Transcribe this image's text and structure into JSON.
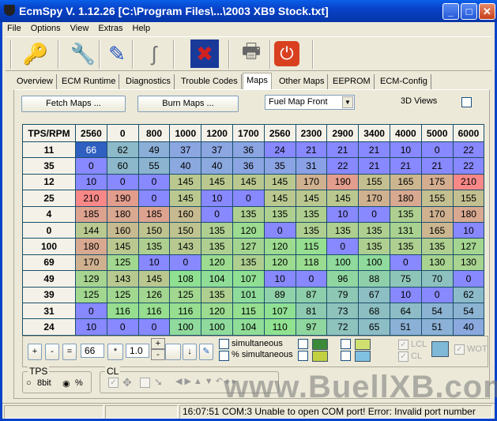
{
  "window": {
    "title": "EcmSpy V. 1.12.26  [C:\\Program Files\\...\\2003 XB9 Stock.txt]"
  },
  "menu": [
    "File",
    "Options",
    "View",
    "Extras",
    "Help"
  ],
  "toolbar": [
    {
      "icon": "keys-icon",
      "glyph": "🔑"
    },
    {
      "icon": "tools-gear-icon",
      "glyph": "🔧"
    },
    {
      "icon": "chip-edit-icon",
      "glyph": "✎"
    },
    {
      "icon": "serial-cable-icon",
      "glyph": "ʃ"
    },
    {
      "icon": "disk-crossed-icon",
      "glyph": "✖"
    },
    {
      "icon": "printer-icon",
      "glyph": "🖶"
    },
    {
      "icon": "power-icon",
      "glyph": "⏻"
    }
  ],
  "tabs": [
    "Overview",
    "ECM Runtime",
    "Diagnostics",
    "Trouble Codes",
    "Maps",
    "Other Maps",
    "EEPROM",
    "ECM-Config"
  ],
  "active_tab": "Maps",
  "maps": {
    "fetch_label": "Fetch Maps ...",
    "burn_label": "Burn Maps ...",
    "map_select": "Fuel Map Front",
    "views_3d_label": "3D Views",
    "corner": "TPS/RPM",
    "rpm": [
      "2560",
      "0",
      "800",
      "1000",
      "1200",
      "1700",
      "2560",
      "2300",
      "2900",
      "3400",
      "4000",
      "5000",
      "6000"
    ],
    "rows": [
      {
        "tps": "11",
        "v": [
          66,
          62,
          49,
          37,
          37,
          36,
          24,
          21,
          21,
          21,
          10,
          0,
          22
        ]
      },
      {
        "tps": "35",
        "v": [
          0,
          60,
          55,
          40,
          40,
          36,
          35,
          31,
          22,
          21,
          21,
          21,
          22
        ]
      },
      {
        "tps": "12",
        "v": [
          10,
          0,
          0,
          145,
          145,
          145,
          145,
          170,
          190,
          155,
          165,
          175,
          210
        ]
      },
      {
        "tps": "25",
        "v": [
          210,
          190,
          0,
          145,
          10,
          0,
          145,
          145,
          145,
          170,
          180,
          155,
          155
        ]
      },
      {
        "tps": "4",
        "v": [
          185,
          180,
          185,
          160,
          0,
          135,
          135,
          135,
          10,
          0,
          135,
          170,
          180
        ]
      },
      {
        "tps": "0",
        "v": [
          144,
          160,
          150,
          150,
          135,
          120,
          0,
          135,
          135,
          135,
          131,
          165,
          10
        ]
      },
      {
        "tps": "100",
        "v": [
          180,
          145,
          135,
          143,
          135,
          127,
          120,
          115,
          0,
          135,
          135,
          135,
          127
        ]
      },
      {
        "tps": "69",
        "v": [
          170,
          125,
          10,
          0,
          120,
          135,
          120,
          118,
          100,
          100,
          0,
          130,
          130
        ]
      },
      {
        "tps": "49",
        "v": [
          129,
          143,
          145,
          108,
          104,
          107,
          10,
          0,
          96,
          88,
          75,
          70,
          0
        ]
      },
      {
        "tps": "39",
        "v": [
          125,
          125,
          126,
          125,
          135,
          101,
          89,
          87,
          79,
          67,
          10,
          0,
          62
        ]
      },
      {
        "tps": "31",
        "v": [
          0,
          116,
          116,
          116,
          120,
          115,
          107,
          81,
          73,
          68,
          64,
          54,
          54
        ]
      },
      {
        "tps": "24",
        "v": [
          10,
          0,
          0,
          100,
          100,
          104,
          110,
          97,
          72,
          65,
          51,
          51,
          40
        ]
      }
    ],
    "selected_value": "66"
  },
  "edit": {
    "plus": "+",
    "minus": "-",
    "equals": "=",
    "value": "66",
    "times": "*",
    "factor": "1.0",
    "spin_up": "+",
    "spin_down": "-",
    "down_arrow": "↓",
    "simultaneous": "simultaneous",
    "pct_simultaneous": "% simultaneous",
    "lcl": "LCL",
    "cl": "CL",
    "wot": "WOT"
  },
  "tps_group": {
    "label": "TPS",
    "opt_8bit": "8bit",
    "opt_pct": "%",
    "selected": "%"
  },
  "cl_group": {
    "label": "CL"
  },
  "status": {
    "message": "16:07:51 COM:3 Unable to open COM port! Error: Invalid port number"
  },
  "watermark": "www.BuellXB.com"
}
